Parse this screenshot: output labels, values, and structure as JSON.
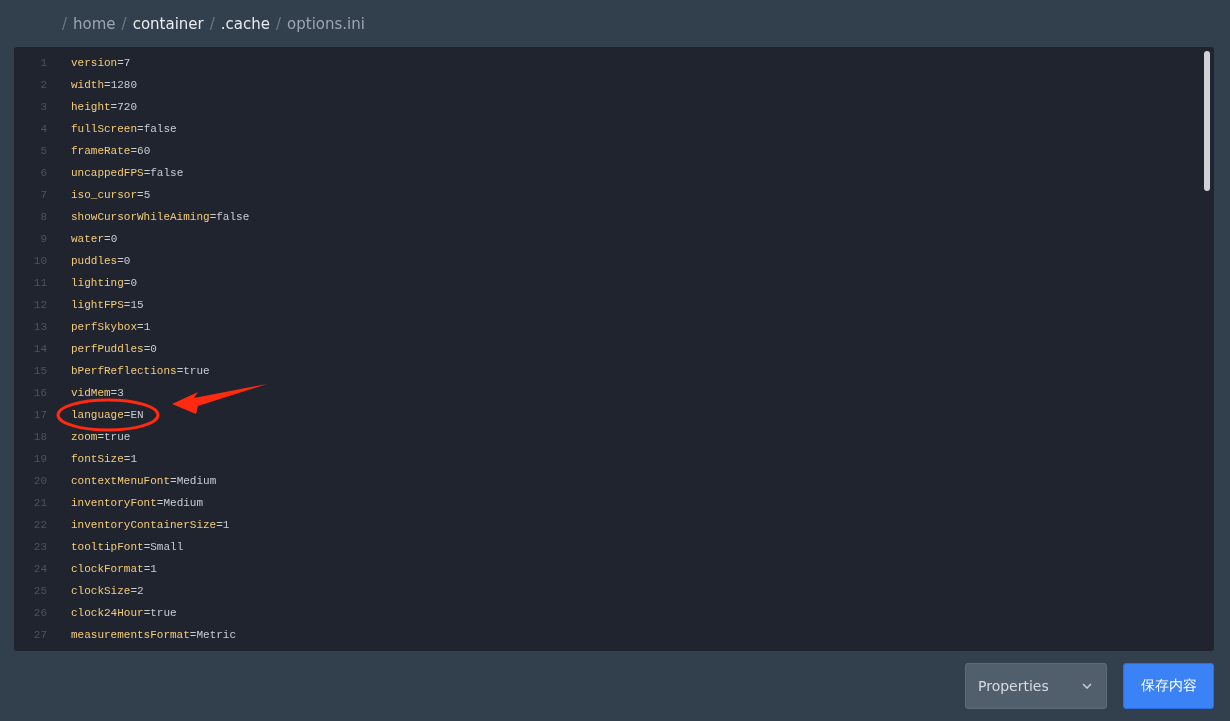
{
  "breadcrumb": {
    "separator": "/",
    "items": [
      {
        "text": "home",
        "emphasis": false
      },
      {
        "text": "container",
        "emphasis": true
      },
      {
        "text": ".cache",
        "emphasis": true
      },
      {
        "text": "options.ini",
        "emphasis": false
      }
    ]
  },
  "editor": {
    "lines": [
      {
        "number": "1",
        "key": "version",
        "sign": "=",
        "value": "7",
        "circled": false
      },
      {
        "number": "2",
        "key": "width",
        "sign": "=",
        "value": "1280",
        "circled": false
      },
      {
        "number": "3",
        "key": "height",
        "sign": "=",
        "value": "720",
        "circled": false
      },
      {
        "number": "4",
        "key": "fullScreen",
        "sign": "=",
        "value": "false",
        "circled": false
      },
      {
        "number": "5",
        "key": "frameRate",
        "sign": "=",
        "value": "60",
        "circled": false
      },
      {
        "number": "6",
        "key": "uncappedFPS",
        "sign": "=",
        "value": "false",
        "circled": false
      },
      {
        "number": "7",
        "key": "iso_cursor",
        "sign": "=",
        "value": "5",
        "circled": false
      },
      {
        "number": "8",
        "key": "showCursorWhileAiming",
        "sign": "=",
        "value": "false",
        "circled": false
      },
      {
        "number": "9",
        "key": "water",
        "sign": "=",
        "value": "0",
        "circled": false
      },
      {
        "number": "10",
        "key": "puddles",
        "sign": "=",
        "value": "0",
        "circled": false
      },
      {
        "number": "11",
        "key": "lighting",
        "sign": "=",
        "value": "0",
        "circled": false
      },
      {
        "number": "12",
        "key": "lightFPS",
        "sign": "=",
        "value": "15",
        "circled": false
      },
      {
        "number": "13",
        "key": "perfSkybox",
        "sign": "=",
        "value": "1",
        "circled": false
      },
      {
        "number": "14",
        "key": "perfPuddles",
        "sign": "=",
        "value": "0",
        "circled": false
      },
      {
        "number": "15",
        "key": "bPerfReflections",
        "sign": "=",
        "value": "true",
        "circled": false
      },
      {
        "number": "16",
        "key": "vidMem",
        "sign": "=",
        "value": "3",
        "circled": false
      },
      {
        "number": "17",
        "key": "language",
        "sign": "=",
        "value": "EN",
        "circled": true
      },
      {
        "number": "18",
        "key": "zoom",
        "sign": "=",
        "value": "true",
        "circled": false
      },
      {
        "number": "19",
        "key": "fontSize",
        "sign": "=",
        "value": "1",
        "circled": false
      },
      {
        "number": "20",
        "key": "contextMenuFont",
        "sign": "=",
        "value": "Medium",
        "circled": false
      },
      {
        "number": "21",
        "key": "inventoryFont",
        "sign": "=",
        "value": "Medium",
        "circled": false
      },
      {
        "number": "22",
        "key": "inventoryContainerSize",
        "sign": "=",
        "value": "1",
        "circled": false
      },
      {
        "number": "23",
        "key": "tooltipFont",
        "sign": "=",
        "value": "Small",
        "circled": false
      },
      {
        "number": "24",
        "key": "clockFormat",
        "sign": "=",
        "value": "1",
        "circled": false
      },
      {
        "number": "25",
        "key": "clockSize",
        "sign": "=",
        "value": "2",
        "circled": false
      },
      {
        "number": "26",
        "key": "clock24Hour",
        "sign": "=",
        "value": "true",
        "circled": false
      },
      {
        "number": "27",
        "key": "measurementsFormat",
        "sign": "=",
        "value": "Metric",
        "circled": false
      }
    ]
  },
  "mode_select": {
    "value": "Properties"
  },
  "save_button": {
    "label": "保存内容"
  }
}
